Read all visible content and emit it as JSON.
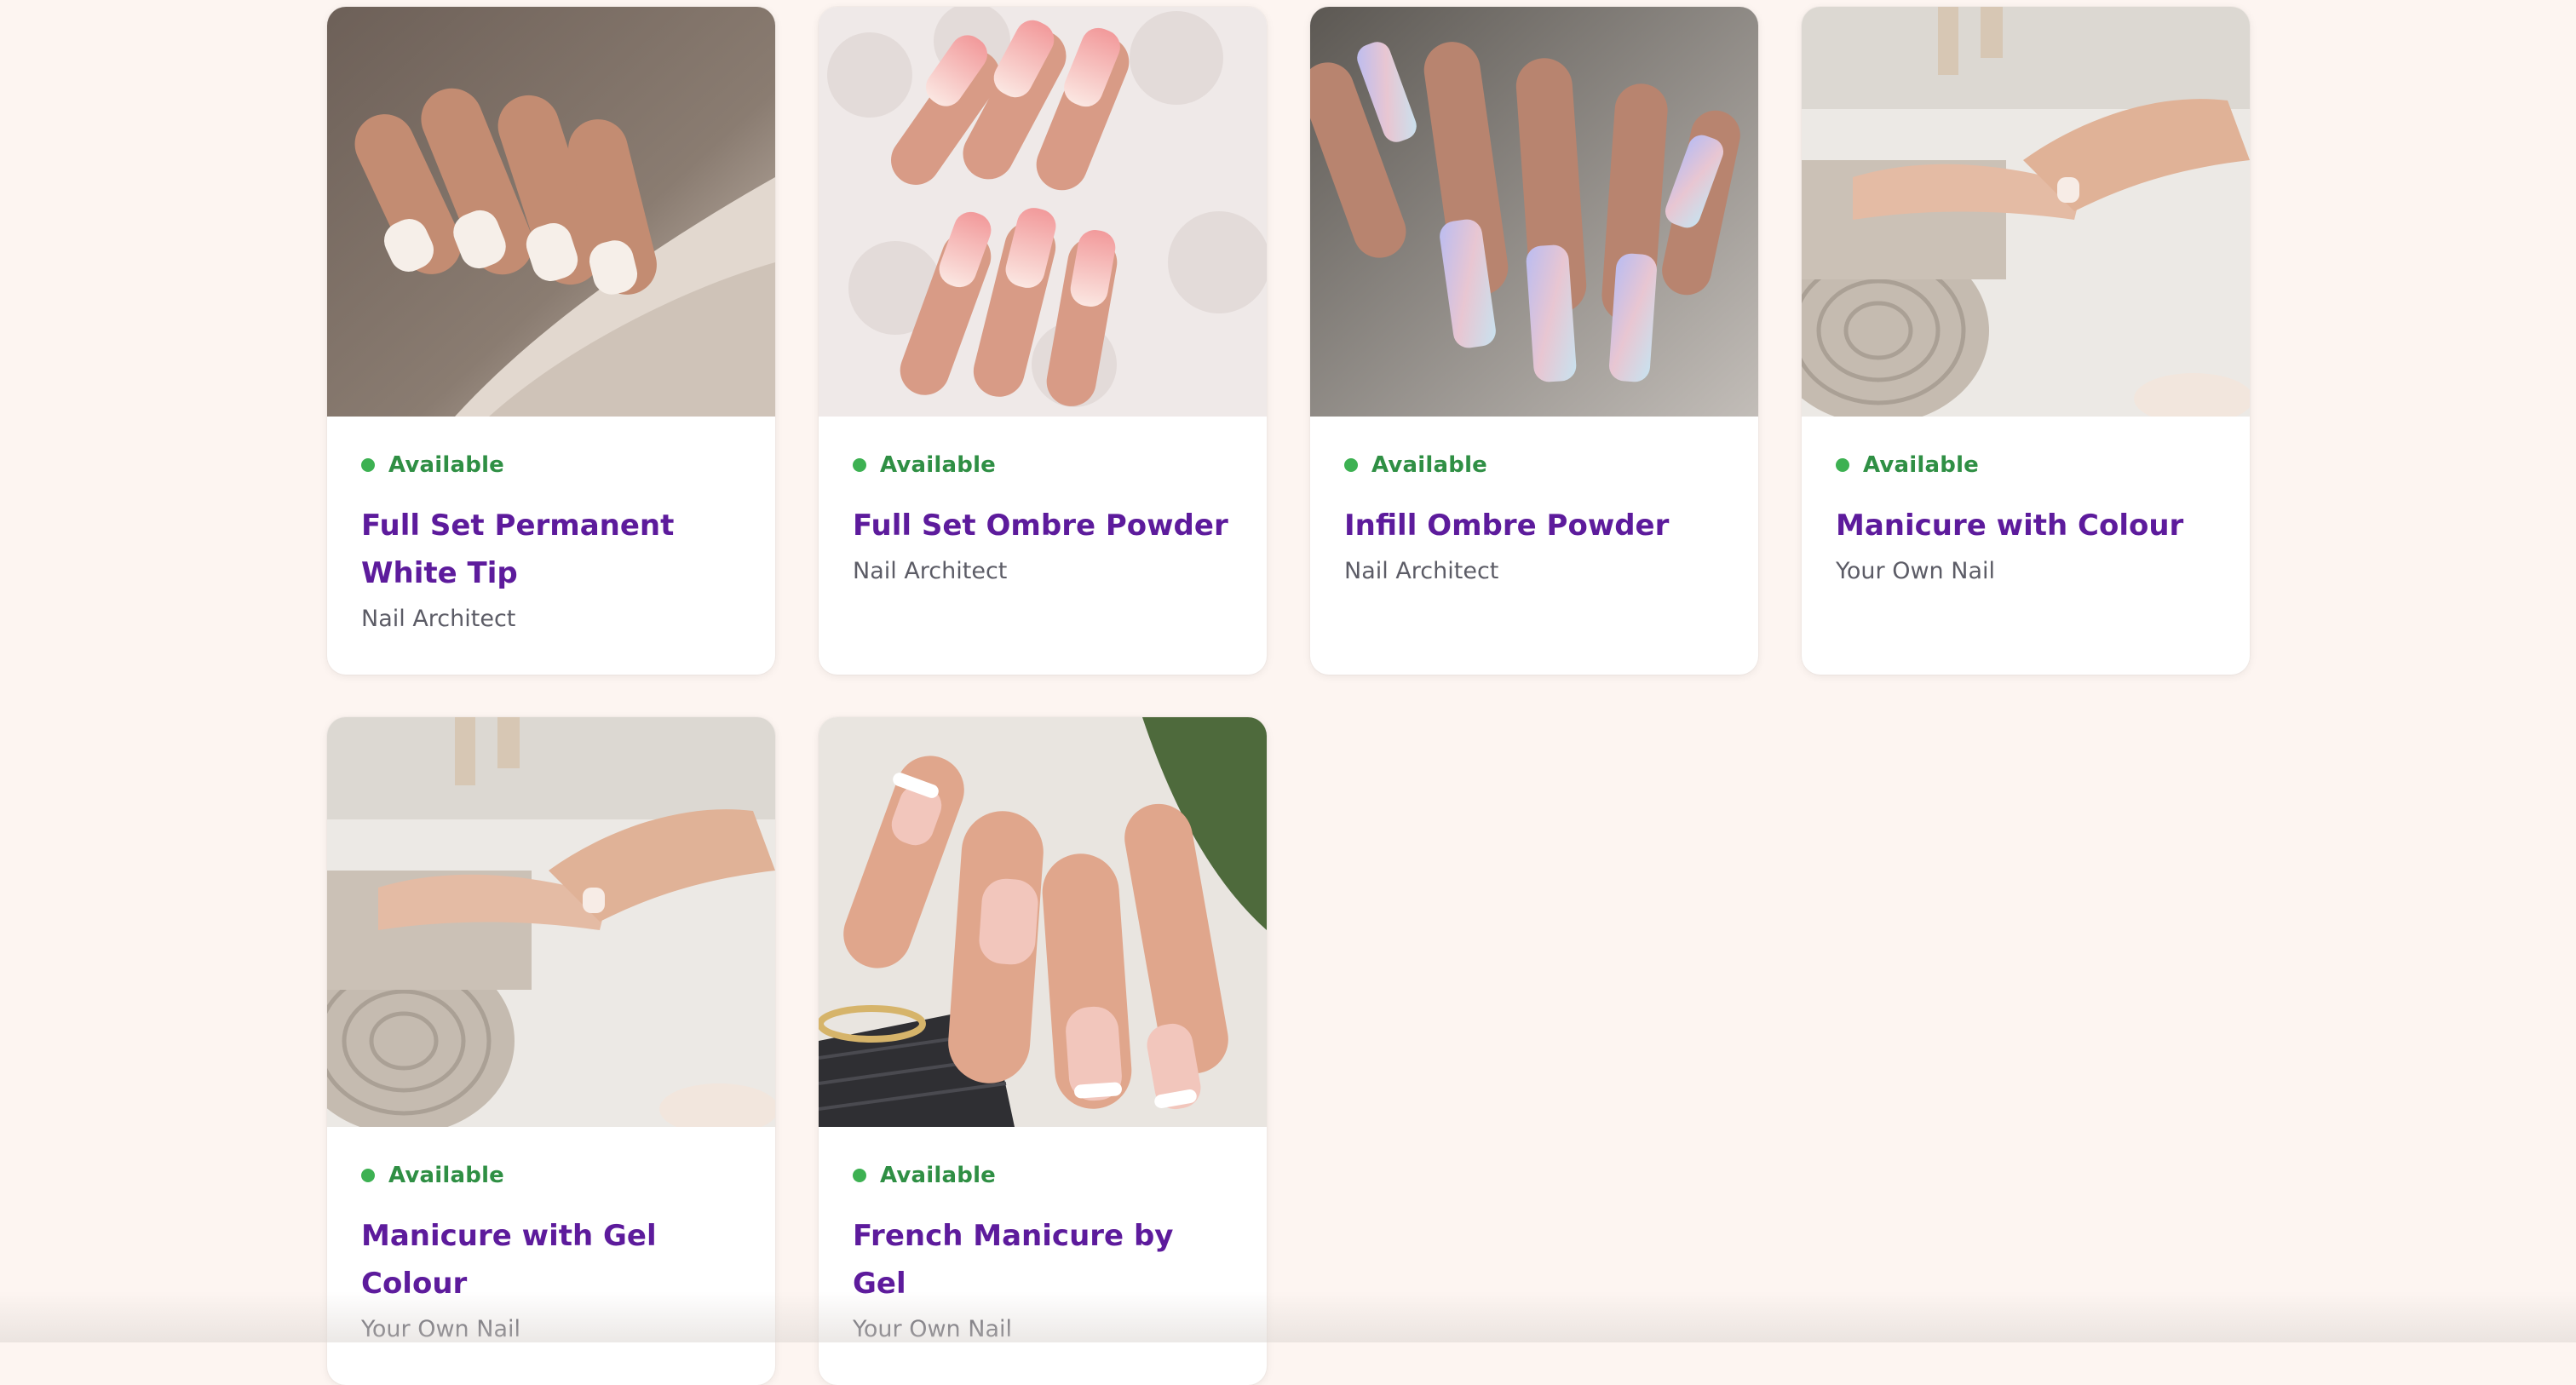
{
  "services": [
    {
      "status": "Available",
      "title": "Full Set Permanent White Tip",
      "category": "Nail Architect",
      "image": "french-tip-nails-photo",
      "palette": {
        "bg": "#7d6f66",
        "bg2": "#cbbfb3",
        "skin": "#c79277",
        "nail": "#f3ece6",
        "tip": "#ffffff"
      }
    },
    {
      "status": "Available",
      "title": "Full Set Ombre Powder",
      "category": "Nail Architect",
      "image": "pink-ombre-nails-photo",
      "palette": {
        "bg": "#f0ebea",
        "bg2": "#d9d1cf",
        "skin": "#d9a08a",
        "nail": "#f09a9c",
        "tip": "#fae8e4"
      }
    },
    {
      "status": "Available",
      "title": "Infill Ombre Powder",
      "category": "Nail Architect",
      "image": "holographic-nails-photo",
      "palette": {
        "bg": "#6d6863",
        "bg2": "#b8b3ae",
        "skin": "#b98671",
        "nail": "#e8c4cc",
        "tip": "#b7b9ef"
      }
    },
    {
      "status": "Available",
      "title": "Manicure with Colour",
      "category": "Your Own Nail",
      "image": "manicure-towel-photo",
      "palette": {
        "bg": "#e9e6e1",
        "bg2": "#c8bfb4",
        "skin": "#e0b69f",
        "nail": "#f4e3da",
        "tip": "#ffffff"
      }
    },
    {
      "status": "Available",
      "title": "Manicure with Gel Colour",
      "category": "Your Own Nail",
      "image": "manicure-towel-photo-2",
      "palette": {
        "bg": "#e9e6e1",
        "bg2": "#c8bfb4",
        "skin": "#e0b69f",
        "nail": "#f4e3da",
        "tip": "#ffffff"
      }
    },
    {
      "status": "Available",
      "title": "French Manicure by Gel",
      "category": "Your Own Nail",
      "image": "french-gel-nails-photo",
      "palette": {
        "bg": "#556b45",
        "bg2": "#e8e4df",
        "skin": "#e2a98f",
        "nail": "#f2c5bb",
        "tip": "#ffffff"
      }
    }
  ],
  "colors": {
    "page_bg": "#fdf5f1",
    "title": "#5d1b9c",
    "available": "#2f8f44",
    "available_dot": "#3db152",
    "category": "#5c5c66"
  }
}
